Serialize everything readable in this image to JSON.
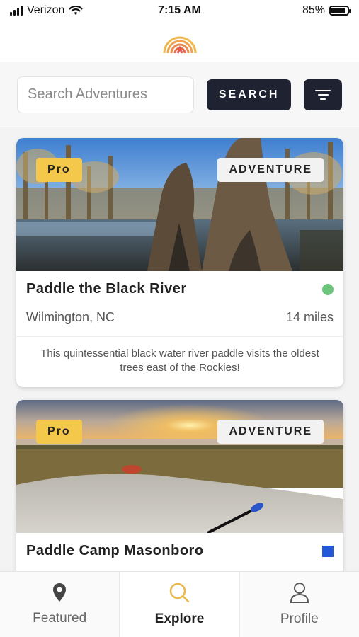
{
  "status_bar": {
    "carrier": "Verizon",
    "time": "7:15 AM",
    "battery": "85%",
    "battery_level": 0.85
  },
  "header": {
    "logo_icon": "rainbow-logo-icon"
  },
  "search": {
    "placeholder": "Search Adventures",
    "value": "",
    "button_label": "SEARCH",
    "filter_icon": "filter-icon"
  },
  "cards": [
    {
      "badge_pro": "Pro",
      "badge_type": "ADVENTURE",
      "title": "Paddle the Black River",
      "location": "Wilmington, NC",
      "distance": "14 miles",
      "status_color": "#6cc57b",
      "status_shape": "circle",
      "description": "This quintessential black water river paddle visits the oldest trees east of the Rockies!"
    },
    {
      "badge_pro": "Pro",
      "badge_type": "ADVENTURE",
      "title": "Paddle Camp Masonboro",
      "status_color": "#2357d9",
      "status_shape": "square"
    }
  ],
  "tabs": [
    {
      "label": "Featured",
      "icon": "map-pin-icon",
      "active": false
    },
    {
      "label": "Explore",
      "icon": "search-icon",
      "active": true
    },
    {
      "label": "Profile",
      "icon": "user-icon",
      "active": false
    }
  ],
  "colors": {
    "accent_dark": "#1f2331",
    "pro_badge": "#f4c84b",
    "active_tab_icon": "#e9b74a"
  }
}
